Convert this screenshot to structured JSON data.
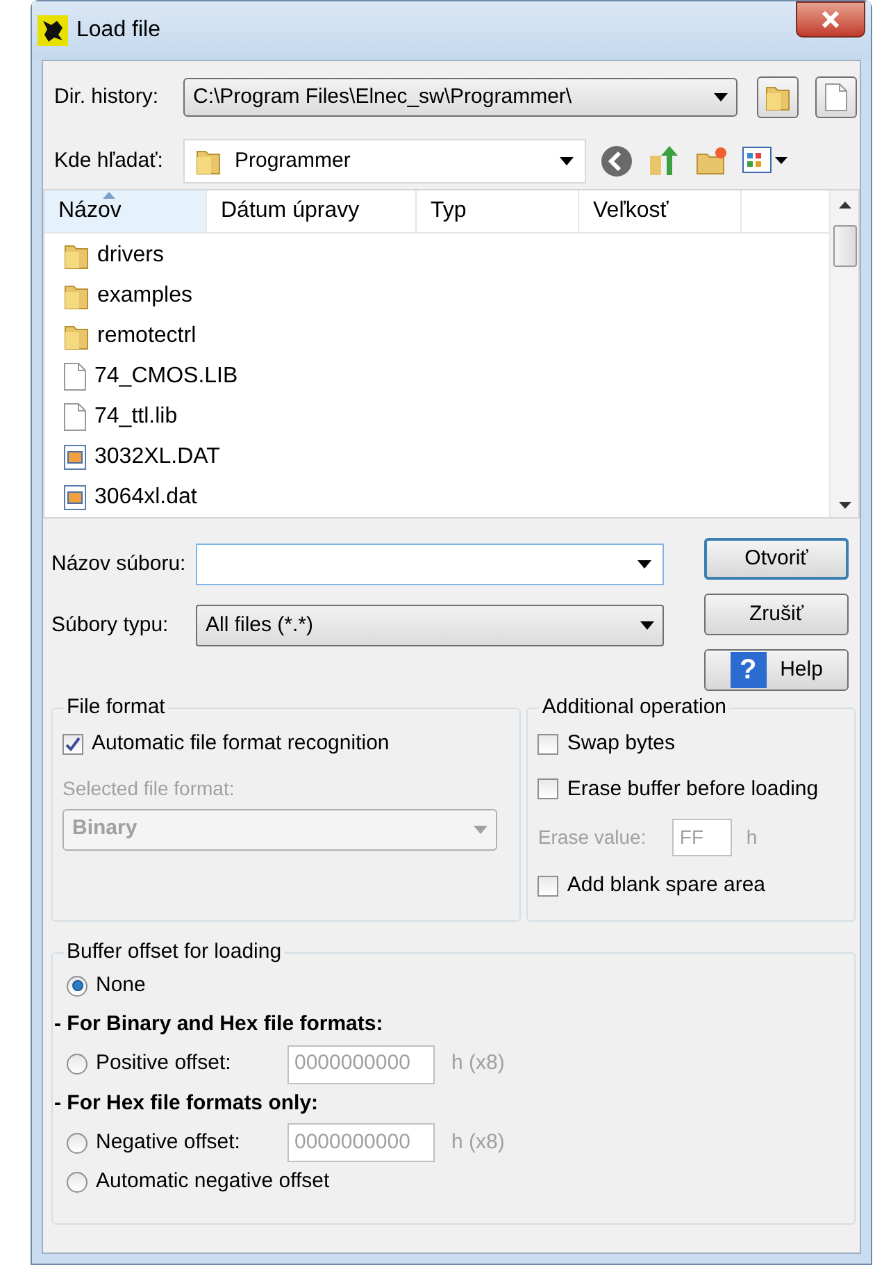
{
  "window": {
    "title": "Load file"
  },
  "dir_history": {
    "label": "Dir. history:",
    "value": "C:\\Program Files\\Elnec_sw\\Programmer\\"
  },
  "look_in": {
    "label": "Kde hľadať:",
    "value": "Programmer"
  },
  "file_list": {
    "columns": [
      {
        "label": "Názov",
        "sorted": true
      },
      {
        "label": "Dátum úpravy",
        "sorted": false
      },
      {
        "label": "Typ",
        "sorted": false
      },
      {
        "label": "Veľkosť",
        "sorted": false
      }
    ],
    "rows": [
      {
        "name": "drivers",
        "kind": "folder"
      },
      {
        "name": "examples",
        "kind": "folder"
      },
      {
        "name": "remotectrl",
        "kind": "folder"
      },
      {
        "name": "74_CMOS.LIB",
        "kind": "file"
      },
      {
        "name": "74_ttl.lib",
        "kind": "file"
      },
      {
        "name": "3032XL.DAT",
        "kind": "data"
      },
      {
        "name": "3064xl.dat",
        "kind": "data"
      }
    ]
  },
  "file_name": {
    "label": "Názov súboru:"
  },
  "file_type": {
    "label": "Súbory typu:",
    "value": "All files (*.*)"
  },
  "buttons": [
    {
      "label": "Otvoriť",
      "kind": "default"
    },
    {
      "label": "Zrušiť",
      "kind": "plain"
    },
    {
      "label": "Help",
      "kind": "help",
      "icon": "?"
    }
  ],
  "file_format": {
    "title": "File format",
    "auto": {
      "label": "Automatic file format recognition",
      "checked": true
    },
    "select_label": "Selected file format:",
    "select_value": "Binary",
    "disabled": true
  },
  "additional": {
    "title": "Additional operation",
    "items": [
      {
        "kind": "checkbox",
        "label": "Swap bytes",
        "checked": false
      },
      {
        "kind": "checkbox",
        "label": "Erase buffer before loading",
        "checked": false
      },
      {
        "kind": "field",
        "label": "Erase value:",
        "value": "FF",
        "unit": "h",
        "disabled": true
      },
      {
        "kind": "checkbox",
        "label": "Add blank spare area",
        "checked": false
      }
    ]
  },
  "buffer_offset": {
    "title": "Buffer offset for loading",
    "items": [
      {
        "kind": "radio",
        "label": "None",
        "selected": true
      },
      {
        "kind": "heading",
        "label": "- For Binary and Hex file formats:"
      },
      {
        "kind": "radio",
        "label": "Positive offset:",
        "selected": false,
        "value": "0000000000",
        "unit": "h (x8)",
        "disabled": true
      },
      {
        "kind": "heading",
        "label": "- For Hex file formats only:"
      },
      {
        "kind": "radio",
        "label": "Negative offset:",
        "selected": false,
        "value": "0000000000",
        "unit": "h (x8)",
        "disabled": true
      },
      {
        "kind": "radio",
        "label": "Automatic negative offset",
        "selected": false
      }
    ]
  }
}
